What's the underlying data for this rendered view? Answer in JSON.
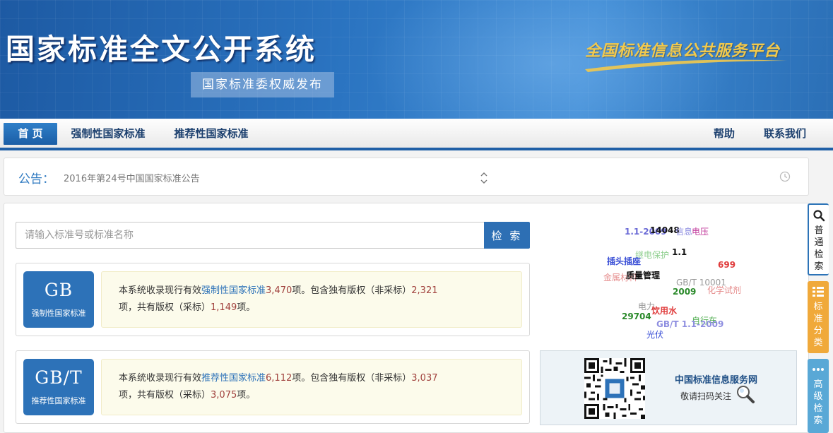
{
  "banner": {
    "title": "国家标准全文公开系统",
    "subtitle": "国家标准委权威发布",
    "slogan": "全国标准信息公共服务平台"
  },
  "nav": {
    "left": [
      "首 页",
      "强制性国家标准",
      "推荐性国家标准"
    ],
    "right": [
      "帮助",
      "联系我们"
    ],
    "active_index": 0
  },
  "notice": {
    "label": "公告：",
    "text": "2016年第24号中国国家标准公告"
  },
  "search": {
    "placeholder": "请输入标准号或标准名称",
    "button": "检 索"
  },
  "standards": [
    {
      "code": "GB",
      "type": "强制性国家标准",
      "text_prefix": "本系统收录现行有效",
      "category": "强制性国家标准",
      "total": "3,470",
      "mid1": "项。包含独有版权（非采标）",
      "exclusive": "2,321",
      "mid2": "项，共有版权（采标）",
      "shared": "1,149",
      "suffix": "项。"
    },
    {
      "code": "GB/T",
      "type": "推荐性国家标准",
      "text_prefix": "本系统收录现行有效",
      "category": "推荐性国家标准",
      "total": "6,112",
      "mid1": "项。包含独有版权（非采标）",
      "exclusive": "3,037",
      "mid2": "项，共有版权（采标）",
      "shared": "3,075",
      "suffix": "项。"
    }
  ],
  "word_cloud": [
    {
      "text": "1.1-2009",
      "color": "#6a6ad6"
    },
    {
      "text": "14048",
      "color": "#111111"
    },
    {
      "text": "信息",
      "color": "#8e8ee0"
    },
    {
      "text": "电压",
      "color": "#c23b9c"
    },
    {
      "text": "继电保护",
      "color": "#8fcf8f"
    },
    {
      "text": "1.1",
      "color": "#111111"
    },
    {
      "text": "插头插座",
      "color": "#3a4fd6"
    },
    {
      "text": "699",
      "color": "#e03c3c"
    },
    {
      "text": "金属材料",
      "color": "#e58b8b"
    },
    {
      "text": "质量管理",
      "color": "#111111"
    },
    {
      "text": "GB/T 10001",
      "color": "#9a9a9a"
    },
    {
      "text": "2009",
      "color": "#2b8a2b"
    },
    {
      "text": "化学试剂",
      "color": "#e58b8b"
    },
    {
      "text": "电力",
      "color": "#9a9a9a"
    },
    {
      "text": "饮用水",
      "color": "#e03c3c"
    },
    {
      "text": "29704",
      "color": "#2b8a2b"
    },
    {
      "text": "自行车",
      "color": "#55b055"
    },
    {
      "text": "GB/T 1.1-2009",
      "color": "#8e8ee0"
    },
    {
      "text": "光伏",
      "color": "#3a4fd6"
    }
  ],
  "qr": {
    "title": "中国标准信息服务网",
    "subtitle": "敬请扫码关注"
  },
  "side_tabs": [
    {
      "label": "普通检索",
      "icon": "search-icon"
    },
    {
      "label": "标准分类",
      "icon": "grid-list-icon"
    },
    {
      "label": "高级检索",
      "icon": "more-dots-icon"
    }
  ],
  "colors": {
    "primary": "#2d72b8",
    "nav_border": "#1f5fa6",
    "number": "#a0403c",
    "slogan": "#f2c94c",
    "tab_class": "#f0a93a",
    "tab_adv": "#59a8d6"
  }
}
